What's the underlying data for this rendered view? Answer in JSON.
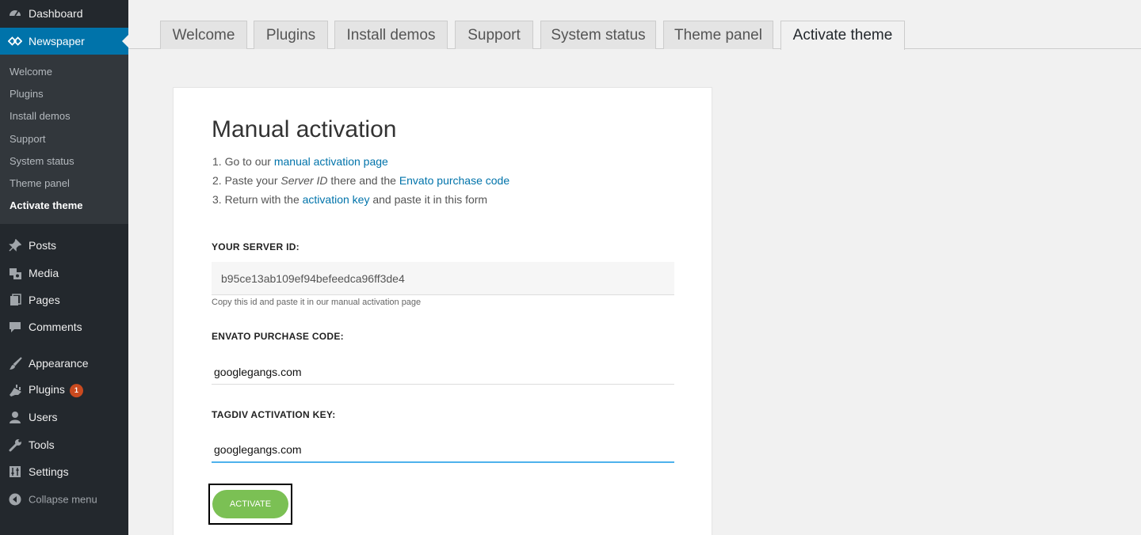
{
  "sidebar": {
    "dashboard": "Dashboard",
    "newspaper": "Newspaper",
    "submenu": [
      "Welcome",
      "Plugins",
      "Install demos",
      "Support",
      "System status",
      "Theme panel",
      "Activate theme"
    ],
    "menu": {
      "posts": "Posts",
      "media": "Media",
      "pages": "Pages",
      "comments": "Comments",
      "appearance": "Appearance",
      "plugins": "Plugins",
      "plugins_badge": "1",
      "users": "Users",
      "tools": "Tools",
      "settings": "Settings",
      "collapse": "Collapse menu"
    }
  },
  "tabs": [
    "Welcome",
    "Plugins",
    "Install demos",
    "Support",
    "System status",
    "Theme panel",
    "Activate theme"
  ],
  "panel": {
    "title": "Manual activation",
    "step1_prefix": "1. Go to our ",
    "step1_link": "manual activation page",
    "step2_prefix": "2. Paste your ",
    "step2_em": "Server ID",
    "step2_mid": " there and the ",
    "step2_link": "Envato purchase code",
    "step3_prefix": "3. Return with the ",
    "step3_link": "activation key",
    "step3_suffix": " and paste it in this form",
    "server_id_label": "YOUR SERVER ID:",
    "server_id_value": "b95ce13ab109ef94befeedca96ff3de4",
    "server_id_hint": "Copy this id and paste it in our manual activation page",
    "purchase_label": "ENVATO PURCHASE CODE:",
    "purchase_value": "googlegangs.com",
    "key_label": "TAGDIV ACTIVATION KEY:",
    "key_value": "googlegangs.com",
    "activate_label": "ACTIVATE"
  },
  "colors": {
    "sidebar_bg": "#23282d",
    "accent": "#0073aa",
    "button": "#7bc054",
    "badge": "#ca4a1f"
  }
}
